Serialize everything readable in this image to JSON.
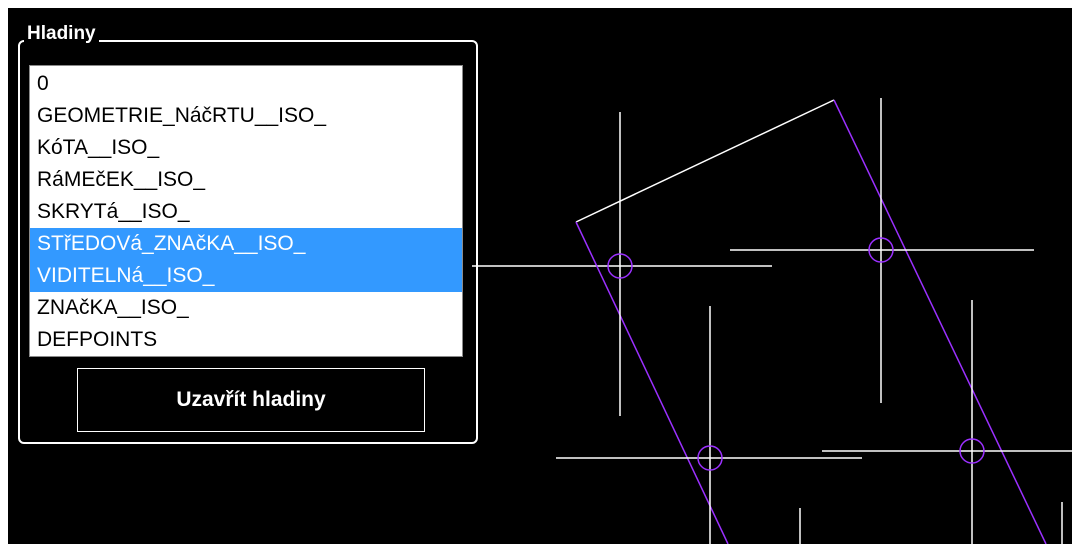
{
  "panel": {
    "title": "Hladiny",
    "layers": [
      {
        "name": "0",
        "selected": false
      },
      {
        "name": "GEOMETRIE_NáčRTU__ISO_",
        "selected": false
      },
      {
        "name": "KóTA__ISO_",
        "selected": false
      },
      {
        "name": "RáMEčEK__ISO_",
        "selected": false
      },
      {
        "name": "SKRYTá__ISO_",
        "selected": false
      },
      {
        "name": "STřEDOVá_ZNAčKA__ISO_",
        "selected": true
      },
      {
        "name": "VIDITELNá__ISO_",
        "selected": true
      },
      {
        "name": "ZNAčKA__ISO_",
        "selected": false
      },
      {
        "name": "DEFPOINTS",
        "selected": false
      }
    ],
    "close_button_label": "Uzavřít hladiny"
  },
  "colors": {
    "background": "#000000",
    "selection": "#3399ff",
    "geometry_lines": "#ffffff",
    "rectangle_outline": "#9b30ff"
  }
}
